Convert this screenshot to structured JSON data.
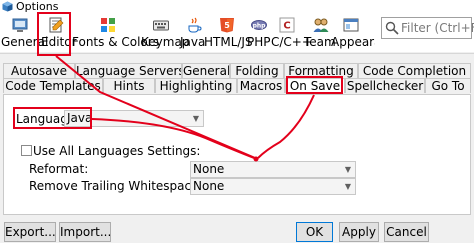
{
  "window": {
    "title": "Options"
  },
  "toolbar": {
    "categories": [
      {
        "label": "General",
        "icon": "general-icon"
      },
      {
        "label": "Editor",
        "icon": "editor-icon"
      },
      {
        "label": "Fonts & Colors",
        "icon": "fonts-colors-icon"
      },
      {
        "label": "Keymap",
        "icon": "keymap-icon"
      },
      {
        "label": "Java",
        "icon": "java-icon"
      },
      {
        "label": "HTML/JS",
        "icon": "html5-icon"
      },
      {
        "label": "PHP",
        "icon": "php-icon"
      },
      {
        "label": "C/C++",
        "icon": "cpp-icon"
      },
      {
        "label": "Team",
        "icon": "team-icon"
      },
      {
        "label": "Appearar",
        "icon": "appearance-icon"
      }
    ],
    "filter_placeholder": "Filter (Ctrl+F)"
  },
  "tabs": {
    "row1": [
      "Autosave",
      "Language Servers",
      "General",
      "Folding",
      "Formatting",
      "Code Completion"
    ],
    "row2": [
      "Code Templates",
      "Hints",
      "Highlighting",
      "Macros",
      "On Save",
      "Spellchecker",
      "Go To"
    ],
    "selected": "On Save"
  },
  "on_save": {
    "language_label": "Language:",
    "language_value": "Java",
    "use_all_label": "Use All Languages Settings:",
    "use_all_checked": false,
    "reformat_label": "Reformat:",
    "reformat_value": "None",
    "remove_ws_label": "Remove Trailing Whitespace From:",
    "remove_ws_value": "None"
  },
  "buttons": {
    "export": "Export...",
    "import": "Import...",
    "ok": "OK",
    "apply": "Apply",
    "cancel": "Cancel"
  },
  "colors": {
    "highlight": "#e3001b",
    "default_button_border": "#0078d7"
  }
}
